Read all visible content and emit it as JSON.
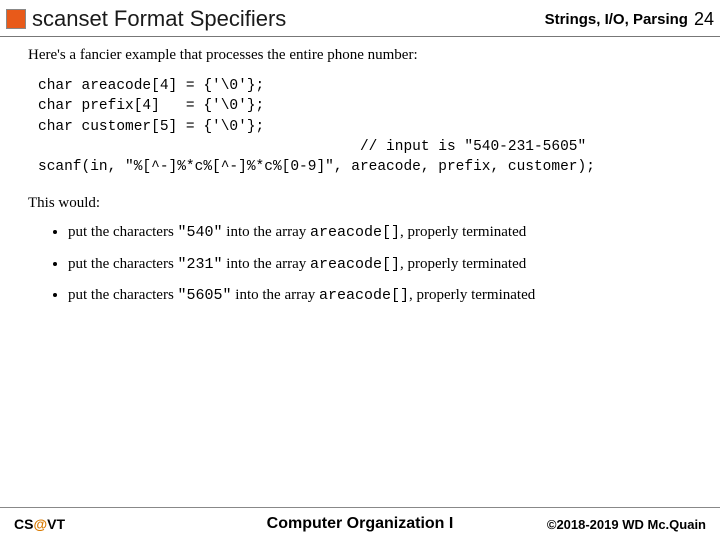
{
  "header": {
    "title": "scanset Format Specifiers",
    "chapter": "Strings, I/O, Parsing",
    "page": "24"
  },
  "intro": "Here's a fancier example that processes the entire phone number:",
  "code_lines": [
    "char areacode[4] = {'\\0'};",
    "char prefix[4]   = {'\\0'};",
    "char customer[5] = {'\\0'};",
    "                                     // input is \"540-231-5605\"",
    "scanf(in, \"%[^-]%*c%[^-]%*c%[0-9]\", areacode, prefix, customer);"
  ],
  "after": "This would:",
  "bullets": [
    {
      "pre": "put the characters ",
      "quote": "\"540\"",
      "mid": " into the array ",
      "arr": "areacode[]",
      "post": ", properly terminated"
    },
    {
      "pre": "put the characters ",
      "quote": "\"231\"",
      "mid": " into the array ",
      "arr": "areacode[]",
      "post": ", properly terminated"
    },
    {
      "pre": "put the characters ",
      "quote": "\"5605\"",
      "mid": " into the array ",
      "arr": "areacode[]",
      "post": ", properly terminated"
    }
  ],
  "footer": {
    "left_pre": "CS",
    "left_at": "@",
    "left_post": "VT",
    "center": "Computer Organization I",
    "right": "©2018-2019 WD Mc.Quain"
  }
}
